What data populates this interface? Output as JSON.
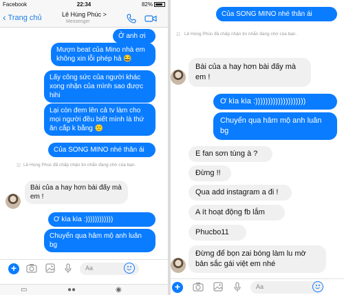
{
  "left": {
    "status": {
      "carrier": "Facebook",
      "time": "22:34",
      "battery": "82%"
    },
    "header": {
      "back_label": "Trang chủ",
      "title": "Lê Hùng Phúc",
      "title_chevron": ">",
      "subtitle": "Messenger"
    },
    "messages": [
      {
        "text": "Ở anh ơi"
      },
      {
        "text": "Mượn beat của Mino nhà em không xin lỗi phép hả 😂"
      },
      {
        "text": "Lấy công sức của người khác xong nhận của mình sao được hihi"
      },
      {
        "text": "Lại còn đem lên cả tv làm cho mọi người đều biết mình là thứ ăn cắp k bằng 🙂"
      },
      {
        "text": "Của SONG MINO nhé thân ái"
      },
      {
        "text": "Lê Hùng Phúc đã chấp nhận tin nhắn đang chờ của bạn."
      },
      {
        "text": "Bài của a hay hơn bài đấy mà em !"
      },
      {
        "text": "Ơ kìa kìa :))))))))))))"
      },
      {
        "text": "Chuyển qua hâm mộ anh luân bg"
      }
    ],
    "composer": {
      "placeholder": "Aa"
    }
  },
  "right": {
    "messages": [
      {
        "text": "Của SONG MINO nhé thân ái"
      },
      {
        "text": "Lê Hùng Phúc đã chấp nhận tin nhắn đang chờ của bạn."
      },
      {
        "text": "Bài của a hay hơn bài đấy mà em !"
      },
      {
        "text": "Ơ kìa kìa :))))))))))))))))))))"
      },
      {
        "text": "Chuyển qua hâm mộ anh luân bg"
      },
      {
        "text": "E fan sơn tùng à ?"
      },
      {
        "text": "Đừng !!"
      },
      {
        "text": "Qua add instagram a đi !"
      },
      {
        "text": "A ít hoạt động fb lắm"
      },
      {
        "text": "Phucbo11"
      },
      {
        "text": "Đừng để bọn zai bóng làm lu mờ bản sắc gái việt em nhé"
      }
    ],
    "composer": {
      "placeholder": "Aa"
    }
  },
  "colors": {
    "outgoing": "#0a7cff",
    "incoming": "#f1f0f0",
    "accent": "#1a7ee6"
  },
  "icons": [
    "back-chevron-icon",
    "phone-icon",
    "video-icon",
    "plus-icon",
    "camera-icon",
    "image-icon",
    "mic-icon",
    "emoji-icon"
  ]
}
